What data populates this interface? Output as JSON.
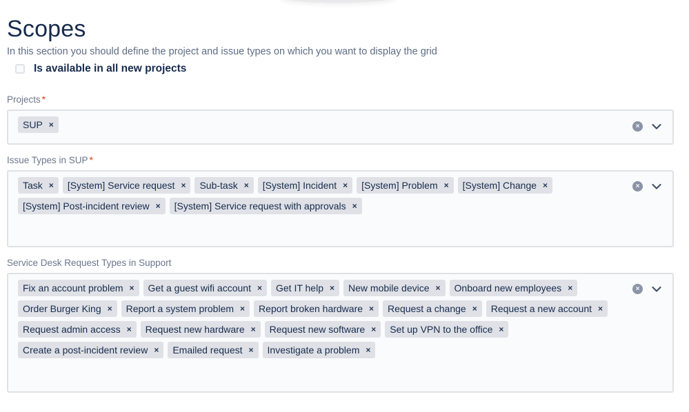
{
  "header": {
    "title": "Scopes",
    "subtitle": "In this section you should define the project and issue types on which you want to display the grid"
  },
  "availability": {
    "checkbox_label": "Is available in all new projects",
    "checked": false
  },
  "projects": {
    "label": "Projects",
    "required_mark": "*",
    "tags": [
      "SUP"
    ]
  },
  "issue_types": {
    "label": "Issue Types in SUP",
    "required_mark": "*",
    "tags": [
      "Task",
      "[System] Service request",
      "Sub-task",
      "[System] Incident",
      "[System] Problem",
      "[System] Change",
      "[System] Post-incident review",
      "[System] Service request with approvals"
    ]
  },
  "request_types": {
    "label": "Service Desk Request Types in Support",
    "tags": [
      "Fix an account problem",
      "Get a guest wifi account",
      "Get IT help",
      "New mobile device",
      "Onboard new employees",
      "Order Burger King",
      "Report a system problem",
      "Report broken hardware",
      "Request a change",
      "Request a new account",
      "Request admin access",
      "Request new hardware",
      "Request new software",
      "Set up VPN to the office",
      "Create a post-incident review",
      "Emailed request",
      "Investigate a problem"
    ]
  },
  "icons": {
    "remove_tag": "×",
    "clear": "×",
    "chevron": "chevron-down-icon",
    "clear_name": "clear-icon"
  },
  "colors": {
    "tag_bg": "#dfe1e6",
    "text": "#172b4d",
    "required": "#de350b",
    "border": "#dfe1e6",
    "field_bg": "#fafbfc"
  }
}
